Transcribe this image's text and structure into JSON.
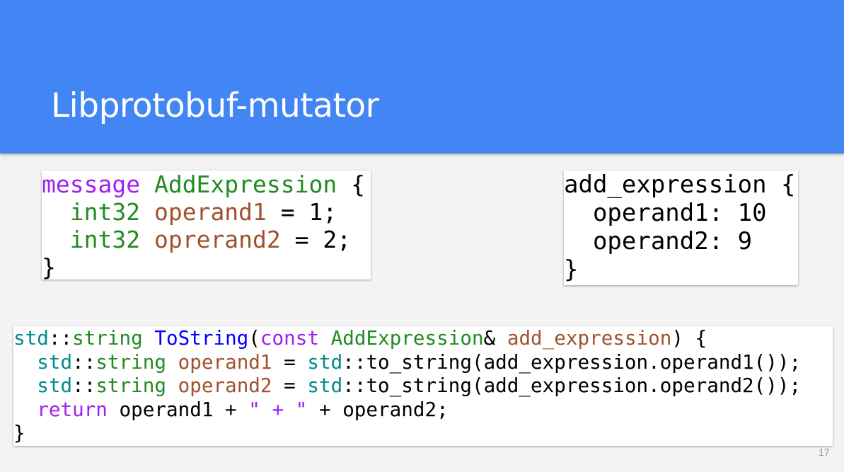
{
  "slide": {
    "title": "Libprotobuf-mutator",
    "slide_number": "17"
  },
  "proto_definition": {
    "lines": [
      [
        {
          "text": "message",
          "color": "purple"
        },
        {
          "text": " "
        },
        {
          "text": "AddExpression",
          "color": "green"
        },
        {
          "text": " {"
        }
      ],
      [
        {
          "text": "  "
        },
        {
          "text": "int32",
          "color": "green"
        },
        {
          "text": " "
        },
        {
          "text": "operand1",
          "color": "brown"
        },
        {
          "text": " = 1;"
        }
      ],
      [
        {
          "text": "  "
        },
        {
          "text": "int32",
          "color": "green"
        },
        {
          "text": " "
        },
        {
          "text": "oprerand2",
          "color": "brown"
        },
        {
          "text": " = 2;"
        }
      ],
      [
        {
          "text": "}"
        }
      ]
    ]
  },
  "text_format_example": {
    "lines": [
      [
        {
          "text": "add_expression {"
        }
      ],
      [
        {
          "text": "  operand1: 10"
        }
      ],
      [
        {
          "text": "  operand2: 9"
        }
      ],
      [
        {
          "text": "}"
        }
      ]
    ]
  },
  "cpp_function": {
    "lines": [
      [
        {
          "text": "std",
          "color": "teal"
        },
        {
          "text": "::"
        },
        {
          "text": "string",
          "color": "green"
        },
        {
          "text": " "
        },
        {
          "text": "ToString",
          "color": "blue"
        },
        {
          "text": "("
        },
        {
          "text": "const",
          "color": "purple"
        },
        {
          "text": " "
        },
        {
          "text": "AddExpression",
          "color": "green"
        },
        {
          "text": "& "
        },
        {
          "text": "add_expression",
          "color": "brown"
        },
        {
          "text": ") {"
        }
      ],
      [
        {
          "text": "  "
        },
        {
          "text": "std",
          "color": "teal"
        },
        {
          "text": "::"
        },
        {
          "text": "string",
          "color": "green"
        },
        {
          "text": " "
        },
        {
          "text": "operand1",
          "color": "brown"
        },
        {
          "text": " = "
        },
        {
          "text": "std",
          "color": "teal"
        },
        {
          "text": "::to_string(add_expression.operand1());"
        }
      ],
      [
        {
          "text": "  "
        },
        {
          "text": "std",
          "color": "teal"
        },
        {
          "text": "::"
        },
        {
          "text": "string",
          "color": "green"
        },
        {
          "text": " "
        },
        {
          "text": "operand2",
          "color": "brown"
        },
        {
          "text": " = "
        },
        {
          "text": "std",
          "color": "teal"
        },
        {
          "text": "::to_string(add_expression.operand2());"
        }
      ],
      [
        {
          "text": "  "
        },
        {
          "text": "return",
          "color": "purple"
        },
        {
          "text": " operand1 + "
        },
        {
          "text": "\" + \"",
          "color": "purple"
        },
        {
          "text": " + operand2;"
        }
      ],
      [
        {
          "text": "}"
        }
      ]
    ]
  },
  "colors": {
    "header_background": "#4285f4",
    "slide_background": "#f3f3f3",
    "keyword_purple": "#a020f0",
    "type_green": "#228b22",
    "namespace_teal": "#008b8b",
    "identifier_brown": "#a0522d",
    "function_blue": "#0000ff"
  }
}
